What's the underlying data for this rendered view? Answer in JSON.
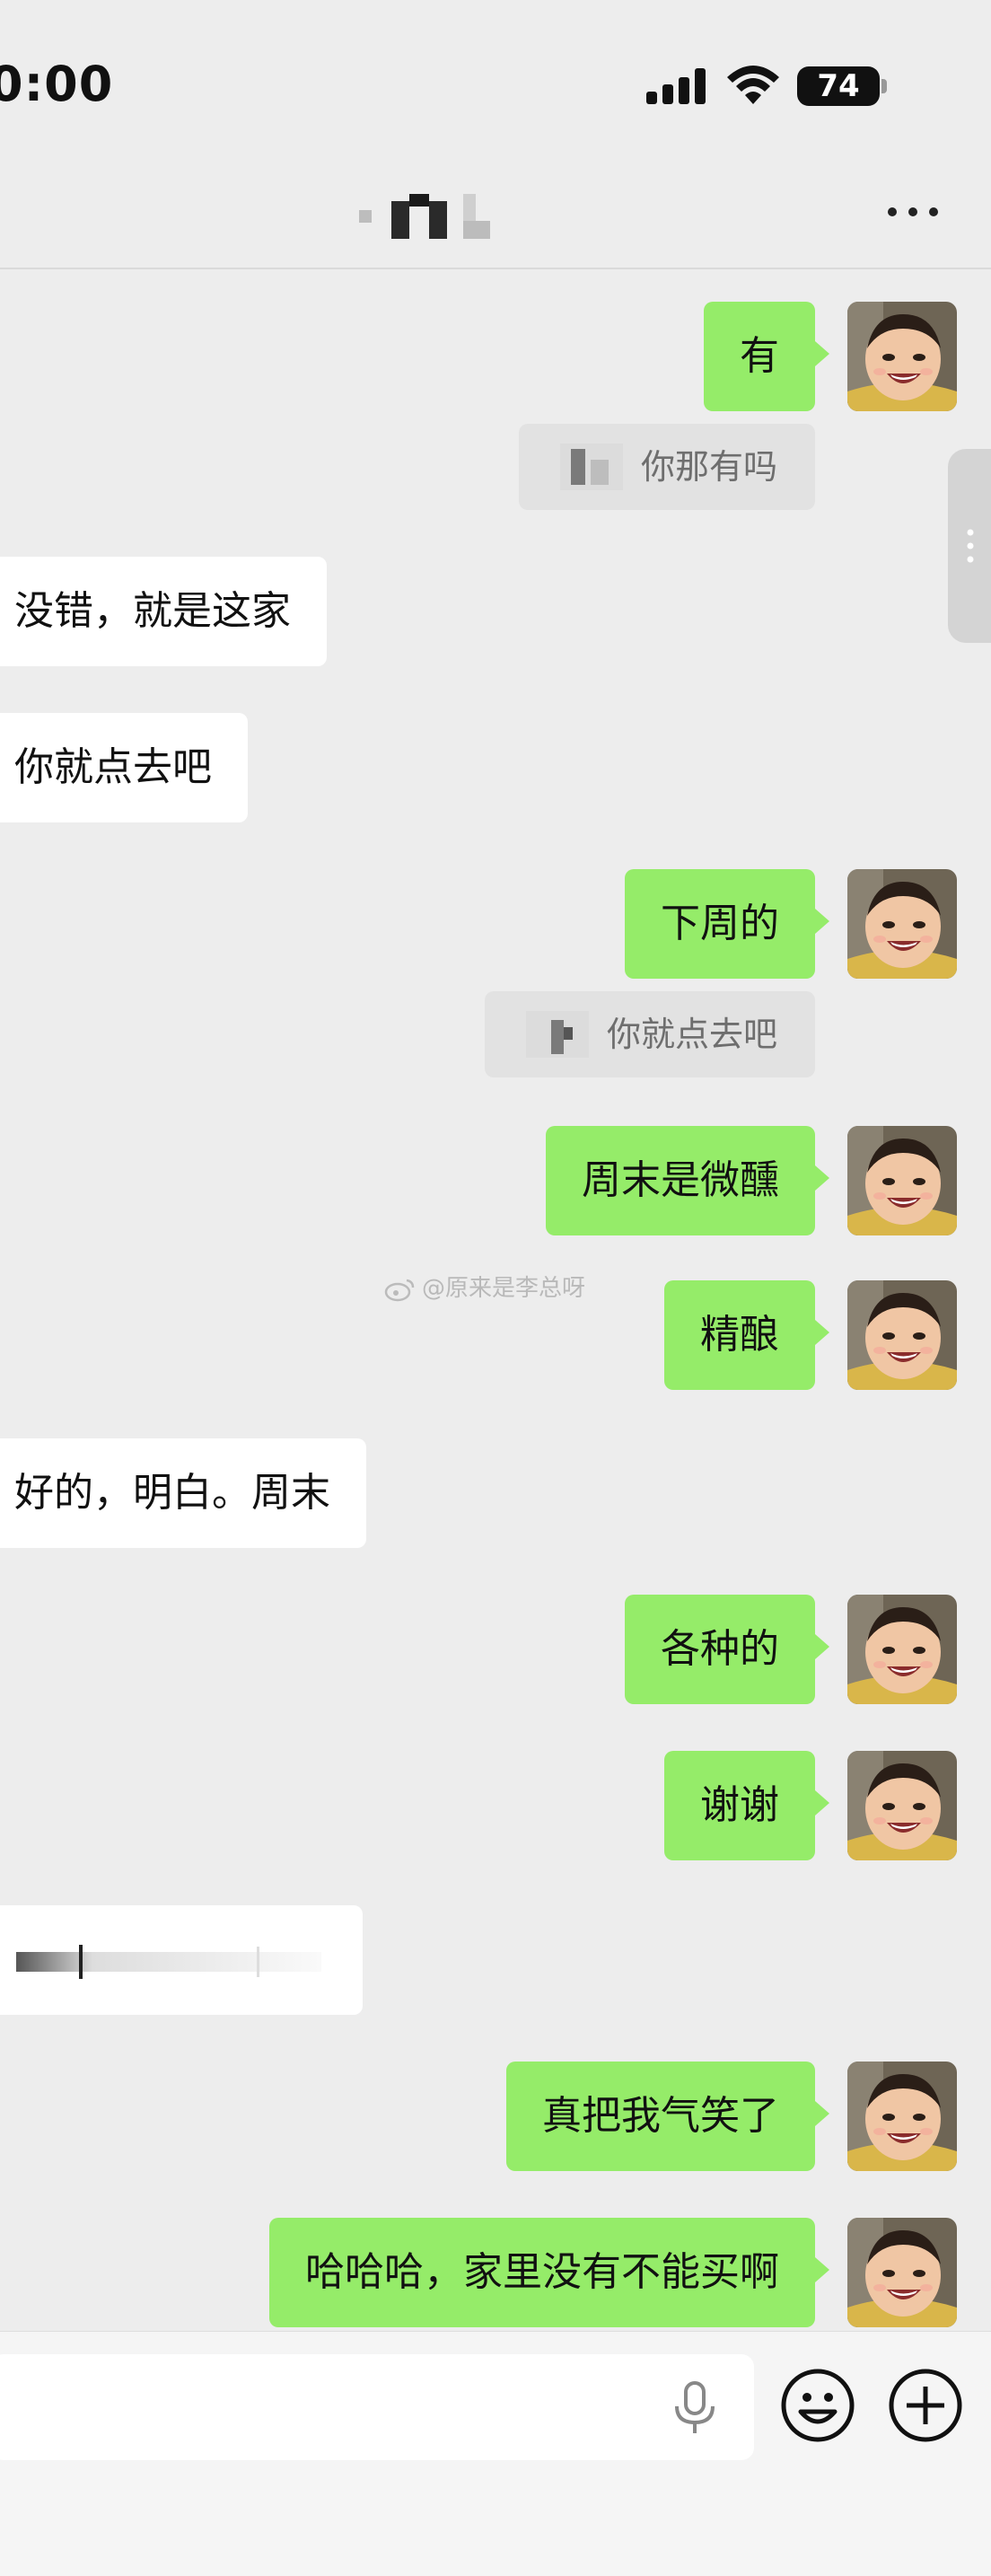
{
  "status_bar": {
    "time": "0:00",
    "battery": "74"
  },
  "nav": {
    "title": "",
    "more_icon": "more-icon"
  },
  "messages": [
    {
      "side": "right",
      "text": "有",
      "quote": null
    },
    {
      "side": "right-quote",
      "text": "你那有吗"
    },
    {
      "side": "left",
      "text": "没错，就是这家"
    },
    {
      "side": "left",
      "text": "你就点去吧"
    },
    {
      "side": "right",
      "text": "下周的"
    },
    {
      "side": "right-quote",
      "text": "你就点去吧"
    },
    {
      "side": "right",
      "text": "周末是微醺"
    },
    {
      "side": "right",
      "text": "精酿"
    },
    {
      "side": "left",
      "text": "好的，明白。周末"
    },
    {
      "side": "right",
      "text": "各种的"
    },
    {
      "side": "right",
      "text": "谢谢"
    },
    {
      "side": "left-voice",
      "text": ""
    },
    {
      "side": "right",
      "text": "真把我气笑了"
    },
    {
      "side": "right",
      "text": "哈哈哈，家里没有不能买啊"
    }
  ],
  "watermark": "@原来是李总呀",
  "input": {
    "placeholder": "",
    "icons": [
      "mic-icon",
      "emoji-icon",
      "plus-icon"
    ]
  },
  "colors": {
    "background": "#ededed",
    "bubble_self": "#95ec69",
    "bubble_other": "#ffffff",
    "quote_bg": "#e2e2e2"
  }
}
